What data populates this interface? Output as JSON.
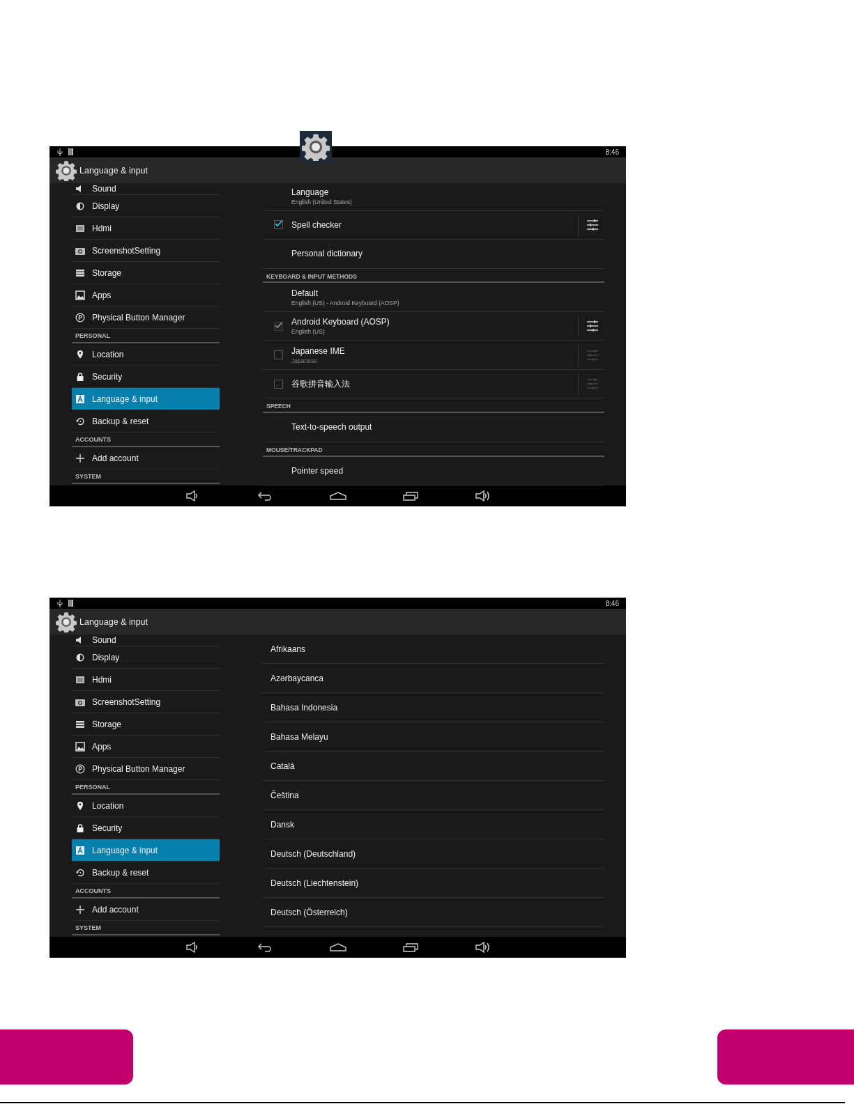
{
  "screens": [
    {
      "floating_settings_icon": true,
      "status_bar": {
        "time": "8:46"
      },
      "action_bar": {
        "title": "Language & input"
      },
      "sidebar": {
        "items": [
          {
            "kind": "item",
            "label": "Sound",
            "selected": false
          },
          {
            "kind": "item",
            "label": "Display",
            "selected": false
          },
          {
            "kind": "item",
            "label": "Hdmi",
            "selected": false
          },
          {
            "kind": "item",
            "label": "ScreenshotSetting",
            "selected": false
          },
          {
            "kind": "item",
            "label": "Storage",
            "selected": false
          },
          {
            "kind": "item",
            "label": "Apps",
            "selected": false
          },
          {
            "kind": "item",
            "label": "Physical Button Manager",
            "selected": false
          },
          {
            "kind": "header",
            "label": "PERSONAL"
          },
          {
            "kind": "item",
            "label": "Location",
            "selected": false
          },
          {
            "kind": "item",
            "label": "Security",
            "selected": false
          },
          {
            "kind": "item",
            "label": "Language & input",
            "selected": true
          },
          {
            "kind": "item",
            "label": "Backup & reset",
            "selected": false
          },
          {
            "kind": "header",
            "label": "ACCOUNTS"
          },
          {
            "kind": "item",
            "label": "Add account",
            "selected": false
          },
          {
            "kind": "header",
            "label": "SYSTEM"
          }
        ]
      },
      "content": {
        "kind": "settings",
        "rows": [
          {
            "kind": "item",
            "title": "Language",
            "subtitle": "English (United States)"
          },
          {
            "kind": "check",
            "title": "Spell checker",
            "checked": true,
            "disabled": false,
            "settings_enabled": true
          },
          {
            "kind": "item",
            "title": "Personal dictionary"
          },
          {
            "kind": "header",
            "title": "KEYBOARD & INPUT METHODS"
          },
          {
            "kind": "item",
            "title": "Default",
            "subtitle": "English (US) - Android Keyboard (AOSP)"
          },
          {
            "kind": "check",
            "title": "Android Keyboard (AOSP)",
            "subtitle": "English (US)",
            "checked": true,
            "disabled": true,
            "settings_enabled": true
          },
          {
            "kind": "check",
            "title": "Japanese IME",
            "subtitle": "Japanese",
            "checked": false,
            "disabled": false,
            "settings_enabled": false
          },
          {
            "kind": "check",
            "title": "谷歌拼音输入法",
            "checked": false,
            "disabled": false,
            "settings_enabled": false
          },
          {
            "kind": "header",
            "title": "SPEECH"
          },
          {
            "kind": "item",
            "title": "Text-to-speech output"
          },
          {
            "kind": "header",
            "title": "MOUSE/TRACKPAD"
          },
          {
            "kind": "item",
            "title": "Pointer speed"
          }
        ]
      }
    },
    {
      "floating_settings_icon": false,
      "status_bar": {
        "time": "8:46"
      },
      "action_bar": {
        "title": "Language & input"
      },
      "sidebar": {
        "items": [
          {
            "kind": "item",
            "label": "Sound",
            "selected": false
          },
          {
            "kind": "item",
            "label": "Display",
            "selected": false
          },
          {
            "kind": "item",
            "label": "Hdmi",
            "selected": false
          },
          {
            "kind": "item",
            "label": "ScreenshotSetting",
            "selected": false
          },
          {
            "kind": "item",
            "label": "Storage",
            "selected": false
          },
          {
            "kind": "item",
            "label": "Apps",
            "selected": false
          },
          {
            "kind": "item",
            "label": "Physical Button Manager",
            "selected": false
          },
          {
            "kind": "header",
            "label": "PERSONAL"
          },
          {
            "kind": "item",
            "label": "Location",
            "selected": false
          },
          {
            "kind": "item",
            "label": "Security",
            "selected": false
          },
          {
            "kind": "item",
            "label": "Language & input",
            "selected": true
          },
          {
            "kind": "item",
            "label": "Backup & reset",
            "selected": false
          },
          {
            "kind": "header",
            "label": "ACCOUNTS"
          },
          {
            "kind": "item",
            "label": "Add account",
            "selected": false
          },
          {
            "kind": "header",
            "label": "SYSTEM"
          }
        ]
      },
      "content": {
        "kind": "picker",
        "rows": [
          {
            "kind": "item",
            "title": "Afrikaans"
          },
          {
            "kind": "item",
            "title": "Azərbaycanca"
          },
          {
            "kind": "item",
            "title": "Bahasa Indonesia"
          },
          {
            "kind": "item",
            "title": "Bahasa Melayu"
          },
          {
            "kind": "item",
            "title": "Català"
          },
          {
            "kind": "item",
            "title": "Čeština"
          },
          {
            "kind": "item",
            "title": "Dansk"
          },
          {
            "kind": "item",
            "title": "Deutsch (Deutschland)"
          },
          {
            "kind": "item",
            "title": "Deutsch (Liechtenstein)"
          },
          {
            "kind": "item",
            "title": "Deutsch (Österreich)"
          }
        ]
      }
    }
  ]
}
